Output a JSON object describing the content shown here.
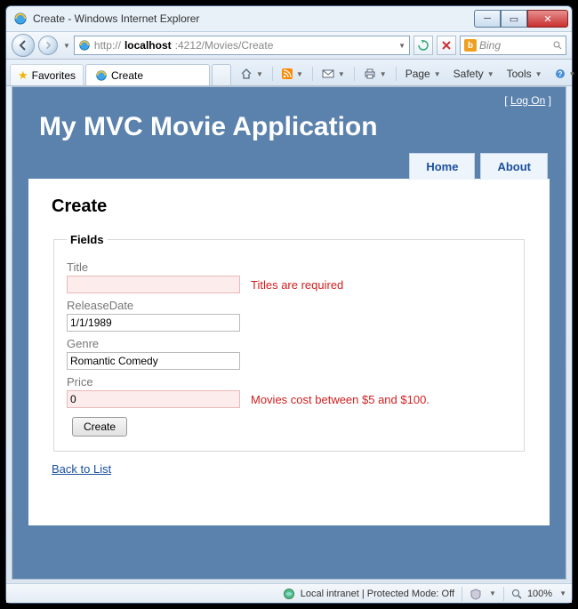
{
  "window": {
    "title": "Create - Windows Internet Explorer"
  },
  "address": {
    "prefix": "http://",
    "host": "localhost",
    "port_path": ":4212/Movies/Create"
  },
  "search": {
    "placeholder": "Bing"
  },
  "favorites_button": "Favorites",
  "tab": {
    "title": "Create"
  },
  "command_bar": {
    "page": "Page",
    "safety": "Safety",
    "tools": "Tools"
  },
  "logon": {
    "left": "[",
    "link": "Log On",
    "right": "]"
  },
  "app": {
    "title": "My MVC Movie Application",
    "nav": {
      "home": "Home",
      "about": "About"
    }
  },
  "page": {
    "heading": "Create",
    "legend": "Fields",
    "fields": {
      "title": {
        "label": "Title",
        "value": "",
        "error": "Titles are required"
      },
      "releaseDate": {
        "label": "ReleaseDate",
        "value": "1/1/1989"
      },
      "genre": {
        "label": "Genre",
        "value": "Romantic Comedy"
      },
      "price": {
        "label": "Price",
        "value": "0",
        "error": "Movies cost between $5 and $100."
      }
    },
    "submit": "Create",
    "back": "Back to List"
  },
  "status": {
    "zone": "Local intranet | Protected Mode: Off",
    "zoom": "100%"
  }
}
